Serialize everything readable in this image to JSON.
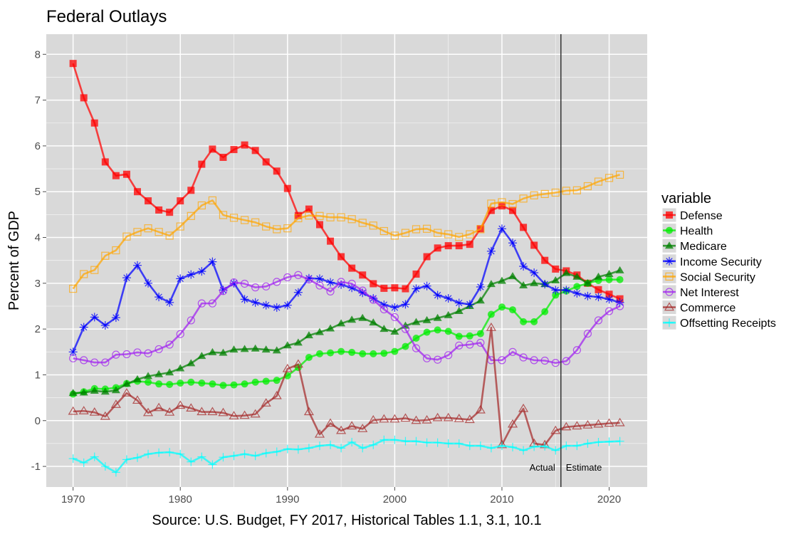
{
  "chart_data": {
    "type": "line",
    "title": "Federal Outlays",
    "xlabel": "Source: U.S. Budget, FY 2017, Historical Tables 1.1, 3.1, 10.1",
    "ylabel": "Percent of GDP",
    "xlim": [
      1967.5,
      2023.55
    ],
    "ylim": [
      -1.45,
      8.44
    ],
    "x_ticks": [
      1970,
      1980,
      1990,
      2000,
      2010,
      2020
    ],
    "x_tick_labels": [
      "1970",
      "1980",
      "1990",
      "2000",
      "2010",
      "2020"
    ],
    "y_ticks": [
      -1,
      0,
      1,
      2,
      3,
      4,
      5,
      6,
      7,
      8
    ],
    "y_tick_labels": [
      "-1",
      "0",
      "1",
      "2",
      "3",
      "4",
      "5",
      "6",
      "7",
      "8"
    ],
    "grid": true,
    "legend_title": "variable",
    "legend_position": "right",
    "x": [
      1970,
      1971,
      1972,
      1973,
      1974,
      1975,
      1976,
      1977,
      1978,
      1979,
      1980,
      1981,
      1982,
      1983,
      1984,
      1985,
      1986,
      1987,
      1988,
      1989,
      1990,
      1991,
      1992,
      1993,
      1994,
      1995,
      1996,
      1997,
      1998,
      1999,
      2000,
      2001,
      2002,
      2003,
      2004,
      2005,
      2006,
      2007,
      2008,
      2009,
      2010,
      2011,
      2012,
      2013,
      2014,
      2015,
      2016,
      2017,
      2018,
      2019,
      2020,
      2021
    ],
    "series": [
      {
        "name": "Defense",
        "color": "#ff0000",
        "marker": "square-filled",
        "values": [
          7.8,
          7.05,
          6.5,
          5.65,
          5.35,
          5.38,
          5.0,
          4.8,
          4.6,
          4.55,
          4.8,
          5.03,
          5.6,
          5.93,
          5.75,
          5.92,
          6.02,
          5.9,
          5.65,
          5.45,
          5.07,
          4.48,
          4.62,
          4.28,
          3.92,
          3.58,
          3.33,
          3.18,
          2.99,
          2.89,
          2.9,
          2.88,
          3.2,
          3.58,
          3.77,
          3.82,
          3.82,
          3.85,
          4.19,
          4.59,
          4.69,
          4.59,
          4.22,
          3.83,
          3.5,
          3.31,
          3.27,
          3.18,
          3.0,
          2.86,
          2.76,
          2.66
        ]
      },
      {
        "name": "Health",
        "color": "#00ee00",
        "marker": "circle-filled",
        "values": [
          0.58,
          0.63,
          0.7,
          0.69,
          0.72,
          0.81,
          0.86,
          0.84,
          0.8,
          0.79,
          0.82,
          0.84,
          0.82,
          0.8,
          0.77,
          0.78,
          0.8,
          0.84,
          0.86,
          0.88,
          0.98,
          1.16,
          1.38,
          1.46,
          1.48,
          1.51,
          1.49,
          1.46,
          1.46,
          1.47,
          1.51,
          1.62,
          1.8,
          1.93,
          1.98,
          1.95,
          1.84,
          1.85,
          1.9,
          2.32,
          2.48,
          2.42,
          2.16,
          2.16,
          2.38,
          2.74,
          2.83,
          2.93,
          3.0,
          3.06,
          3.08,
          3.08
        ]
      },
      {
        "name": "Medicare",
        "color": "#008000",
        "marker": "triangle-filled",
        "values": [
          0.6,
          0.61,
          0.65,
          0.63,
          0.66,
          0.8,
          0.9,
          0.97,
          1.01,
          1.05,
          1.14,
          1.25,
          1.41,
          1.49,
          1.48,
          1.55,
          1.56,
          1.57,
          1.55,
          1.53,
          1.64,
          1.7,
          1.86,
          1.93,
          2.01,
          2.12,
          2.2,
          2.24,
          2.14,
          2.0,
          1.94,
          2.07,
          2.15,
          2.19,
          2.24,
          2.3,
          2.39,
          2.5,
          2.62,
          2.98,
          3.05,
          3.15,
          2.95,
          3.0,
          2.98,
          3.06,
          3.22,
          3.14,
          3.0,
          3.14,
          3.2,
          3.28
        ]
      },
      {
        "name": "Income Security",
        "color": "#0000ff",
        "marker": "asterisk",
        "values": [
          1.5,
          2.04,
          2.26,
          2.08,
          2.25,
          3.12,
          3.39,
          3.0,
          2.7,
          2.58,
          3.1,
          3.19,
          3.26,
          3.47,
          2.85,
          3.0,
          2.65,
          2.58,
          2.52,
          2.47,
          2.52,
          2.8,
          3.11,
          3.1,
          3.02,
          2.97,
          2.9,
          2.79,
          2.67,
          2.53,
          2.47,
          2.54,
          2.88,
          2.94,
          2.74,
          2.67,
          2.57,
          2.54,
          2.92,
          3.7,
          4.19,
          3.88,
          3.37,
          3.23,
          2.98,
          2.85,
          2.85,
          2.78,
          2.72,
          2.7,
          2.65,
          2.58
        ]
      },
      {
        "name": "Social Security",
        "color": "#ffa500",
        "marker": "square-open",
        "values": [
          2.88,
          3.2,
          3.29,
          3.6,
          3.72,
          4.02,
          4.12,
          4.2,
          4.12,
          4.04,
          4.24,
          4.47,
          4.7,
          4.81,
          4.49,
          4.43,
          4.38,
          4.33,
          4.24,
          4.18,
          4.2,
          4.42,
          4.48,
          4.47,
          4.44,
          4.44,
          4.4,
          4.32,
          4.26,
          4.14,
          4.04,
          4.1,
          4.18,
          4.19,
          4.1,
          4.07,
          4.01,
          4.07,
          4.18,
          4.74,
          4.77,
          4.73,
          4.85,
          4.92,
          4.95,
          4.98,
          5.02,
          5.03,
          5.12,
          5.22,
          5.3,
          5.37
        ]
      },
      {
        "name": "Net Interest",
        "color": "#a020f0",
        "marker": "circle-open",
        "values": [
          1.36,
          1.32,
          1.27,
          1.27,
          1.44,
          1.45,
          1.49,
          1.47,
          1.56,
          1.66,
          1.89,
          2.19,
          2.56,
          2.56,
          2.83,
          3.02,
          2.99,
          2.91,
          2.93,
          3.03,
          3.13,
          3.18,
          3.08,
          2.95,
          2.82,
          3.03,
          2.99,
          2.84,
          2.64,
          2.43,
          2.26,
          2.0,
          1.58,
          1.36,
          1.33,
          1.43,
          1.64,
          1.66,
          1.7,
          1.32,
          1.32,
          1.5,
          1.38,
          1.32,
          1.31,
          1.26,
          1.3,
          1.54,
          1.9,
          2.19,
          2.39,
          2.5
        ]
      },
      {
        "name": "Commerce",
        "color": "#a52a2a",
        "marker": "triangle-open",
        "values": [
          0.2,
          0.21,
          0.18,
          0.09,
          0.35,
          0.6,
          0.44,
          0.17,
          0.28,
          0.18,
          0.33,
          0.27,
          0.19,
          0.19,
          0.17,
          0.1,
          0.11,
          0.14,
          0.38,
          0.54,
          1.13,
          1.23,
          0.19,
          -0.3,
          -0.06,
          -0.22,
          -0.12,
          -0.18,
          0.01,
          0.03,
          0.03,
          0.05,
          0.0,
          0.01,
          0.06,
          0.06,
          0.04,
          0.02,
          0.23,
          2.03,
          -0.53,
          -0.08,
          0.26,
          -0.5,
          -0.53,
          -0.22,
          -0.14,
          -0.12,
          -0.1,
          -0.08,
          -0.06,
          -0.05
        ]
      },
      {
        "name": "Offsetting Receipts",
        "color": "#00ffff",
        "marker": "plus",
        "values": [
          -0.83,
          -0.92,
          -0.79,
          -1.0,
          -1.13,
          -0.85,
          -0.81,
          -0.73,
          -0.7,
          -0.69,
          -0.73,
          -0.9,
          -0.79,
          -0.96,
          -0.8,
          -0.77,
          -0.73,
          -0.77,
          -0.71,
          -0.68,
          -0.62,
          -0.63,
          -0.6,
          -0.55,
          -0.53,
          -0.6,
          -0.47,
          -0.6,
          -0.53,
          -0.42,
          -0.42,
          -0.45,
          -0.45,
          -0.48,
          -0.48,
          -0.5,
          -0.5,
          -0.55,
          -0.55,
          -0.6,
          -0.55,
          -0.58,
          -0.65,
          -0.57,
          -0.56,
          -0.65,
          -0.55,
          -0.55,
          -0.5,
          -0.47,
          -0.46,
          -0.45
        ]
      }
    ],
    "vline": {
      "x": 2015.5,
      "label_left": "Actual",
      "label_right": "Estimate",
      "y": -1
    }
  }
}
